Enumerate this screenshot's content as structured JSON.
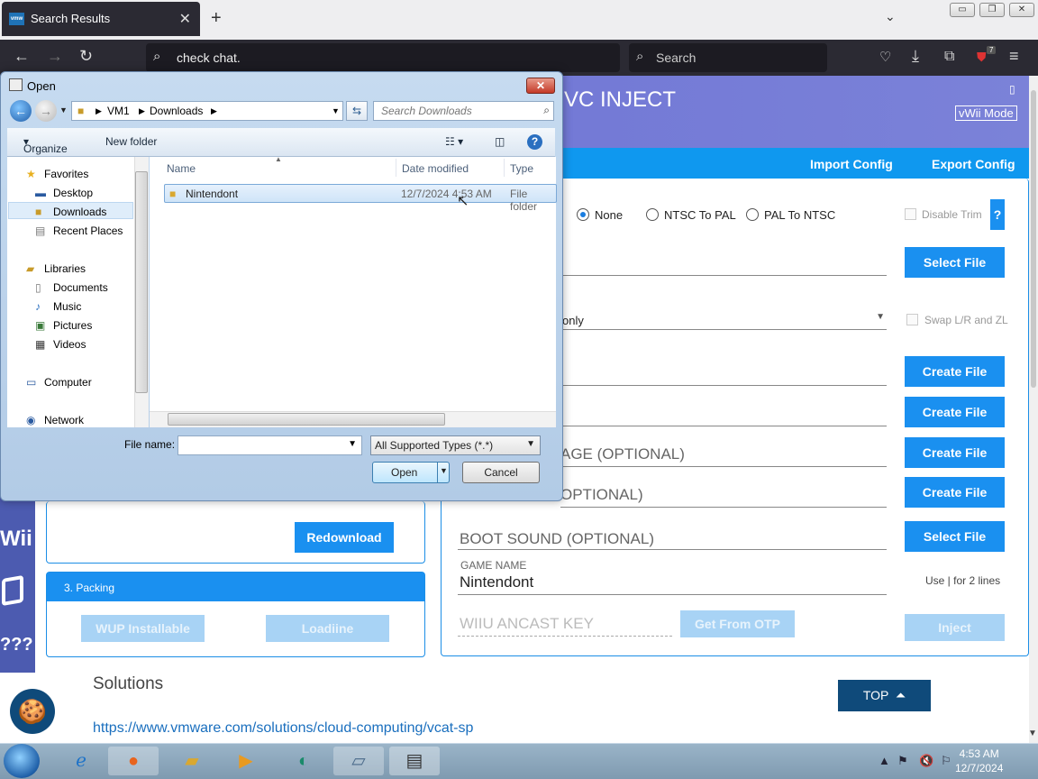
{
  "browser": {
    "tab_title": "Search Results",
    "tab_favicon": "vmw",
    "new_tab": "+",
    "url": "check chat.",
    "search_placeholder": "Search",
    "extension_badge": "7"
  },
  "app": {
    "title": "VC INJECT",
    "mode_button": "vWii Mode",
    "import_config": "Import Config",
    "export_config": "Export Config",
    "radio_none": "None",
    "radio_ntsc_pal": "NTSC To PAL",
    "radio_pal_ntsc": "PAL To NTSC",
    "disable_trim": "Disable Trim",
    "help_button": "?",
    "select_file_1": "Select File",
    "dropdown_partial": "only",
    "swap_lr": "Swap L/R and ZL",
    "create_file_1": "Create File",
    "create_file_2": "Create File",
    "create_file_3": "Create File",
    "create_file_4": "Create File",
    "label_image_partial": "AGE (OPTIONAL)",
    "label_optional_partial": "OPTIONAL)",
    "boot_sound_label": "BOOT SOUND (OPTIONAL)",
    "select_file_2": "Select File",
    "game_name_label": "GAME NAME",
    "game_name_value": "Nintendont",
    "two_lines_hint": "Use | for 2 lines",
    "ancast_placeholder": "WIIU ANCAST KEY",
    "get_from_otp": "Get From OTP",
    "inject": "Inject",
    "redownload": "Redownload",
    "packing_header": "3. Packing",
    "wup_installable": "WUP Installable",
    "loadiine": "Loadiine",
    "rail_wii": "Wii",
    "rail_q": "???"
  },
  "webpage": {
    "solutions": "Solutions",
    "link": "https://www.vmware.com/solutions/cloud-computing/vcat-sp",
    "top_button": "TOP"
  },
  "dialog": {
    "title": "Open",
    "breadcrumb": [
      "VM1",
      "Downloads"
    ],
    "search_placeholder": "Search Downloads",
    "organize": "Organize",
    "new_folder": "New folder",
    "nav": {
      "favorites": "Favorites",
      "desktop": "Desktop",
      "downloads": "Downloads",
      "recent": "Recent Places",
      "libraries": "Libraries",
      "documents": "Documents",
      "music": "Music",
      "pictures": "Pictures",
      "videos": "Videos",
      "computer": "Computer",
      "network": "Network"
    },
    "columns": [
      "Name",
      "Date modified",
      "Type"
    ],
    "files": [
      {
        "name": "Nintendont",
        "date": "12/7/2024 4:53 AM",
        "type": "File folder"
      }
    ],
    "file_name_label": "File name:",
    "file_name_value": "",
    "filter": "All Supported Types (*.*)",
    "open": "Open",
    "cancel": "Cancel"
  },
  "taskbar": {
    "time": "4:53 AM",
    "date": "12/7/2024"
  }
}
